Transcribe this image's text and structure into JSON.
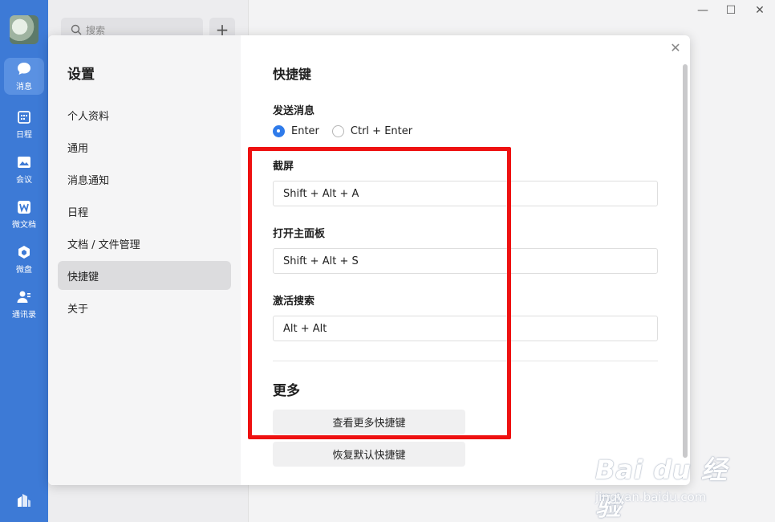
{
  "rail": {
    "items": [
      {
        "label": "消息",
        "icon": "chat-bubble-icon",
        "active": true
      },
      {
        "label": "日程",
        "icon": "calendar-icon"
      },
      {
        "label": "会议",
        "icon": "meeting-icon"
      },
      {
        "label": "微文档",
        "icon": "document-w-icon"
      },
      {
        "label": "微盘",
        "icon": "cloud-drive-icon"
      },
      {
        "label": "通讯录",
        "icon": "contacts-icon"
      }
    ],
    "accent": "#3d7ad6"
  },
  "list": {
    "search_placeholder": "搜索",
    "add_symbol": "+"
  },
  "window": {
    "minimize": "—",
    "maximize": "☐",
    "close": "✕"
  },
  "dialog": {
    "side_title": "设置",
    "nav": [
      {
        "label": "个人资料"
      },
      {
        "label": "通用"
      },
      {
        "label": "消息通知"
      },
      {
        "label": "日程"
      },
      {
        "label": "文档 / 文件管理"
      },
      {
        "label": "快捷键",
        "active": true
      },
      {
        "label": "关于"
      }
    ],
    "close_symbol": "✕",
    "title": "快捷键",
    "send": {
      "label": "发送消息",
      "options": [
        {
          "label": "Enter",
          "checked": true
        },
        {
          "label": "Ctrl + Enter",
          "checked": false
        }
      ]
    },
    "screenshot": {
      "label": "截屏",
      "value": "Shift + Alt + A"
    },
    "open_panel": {
      "label": "打开主面板",
      "value": "Shift + Alt + S"
    },
    "activate_search": {
      "label": "激活搜索",
      "value": "Alt + Alt"
    },
    "more": {
      "title": "更多",
      "view_more_button": "查看更多快捷键",
      "restore_button": "恢复默认快捷键"
    },
    "highlight_color": "#ee1111"
  },
  "watermark": {
    "logo": "Bai du 经验",
    "url": "jingyan.baidu.com"
  }
}
